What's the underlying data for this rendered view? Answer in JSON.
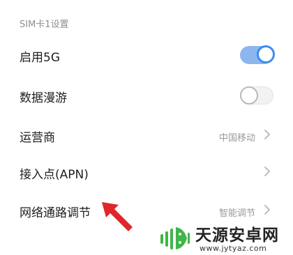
{
  "section_title": "SIM卡1设置",
  "rows": [
    {
      "label": "启用5G",
      "toggle": "on",
      "toggle_color": "#3d8bf2"
    },
    {
      "label": "数据漫游",
      "toggle": "off"
    },
    {
      "label": "运营商",
      "value": "中国移动"
    },
    {
      "label": "接入点(APN)",
      "value": ""
    },
    {
      "label": "网络通路调节",
      "value": "智能调节"
    }
  ],
  "annotation_arrow_color": "#e0262d",
  "watermark": {
    "title": "天源安卓网",
    "url": "www.jytyaz.com",
    "logo_color": "#3fb54a"
  }
}
